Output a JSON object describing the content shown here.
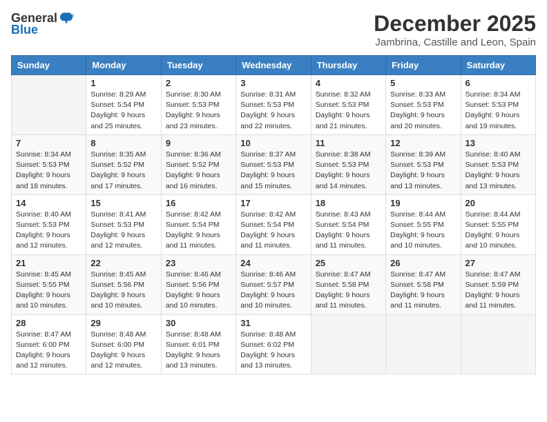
{
  "logo": {
    "general": "General",
    "blue": "Blue"
  },
  "title": "December 2025",
  "location": "Jambrina, Castille and Leon, Spain",
  "weekdays": [
    "Sunday",
    "Monday",
    "Tuesday",
    "Wednesday",
    "Thursday",
    "Friday",
    "Saturday"
  ],
  "weeks": [
    [
      {
        "day": "",
        "info": ""
      },
      {
        "day": "1",
        "info": "Sunrise: 8:29 AM\nSunset: 5:54 PM\nDaylight: 9 hours\nand 25 minutes."
      },
      {
        "day": "2",
        "info": "Sunrise: 8:30 AM\nSunset: 5:53 PM\nDaylight: 9 hours\nand 23 minutes."
      },
      {
        "day": "3",
        "info": "Sunrise: 8:31 AM\nSunset: 5:53 PM\nDaylight: 9 hours\nand 22 minutes."
      },
      {
        "day": "4",
        "info": "Sunrise: 8:32 AM\nSunset: 5:53 PM\nDaylight: 9 hours\nand 21 minutes."
      },
      {
        "day": "5",
        "info": "Sunrise: 8:33 AM\nSunset: 5:53 PM\nDaylight: 9 hours\nand 20 minutes."
      },
      {
        "day": "6",
        "info": "Sunrise: 8:34 AM\nSunset: 5:53 PM\nDaylight: 9 hours\nand 19 minutes."
      }
    ],
    [
      {
        "day": "7",
        "info": "Sunrise: 8:34 AM\nSunset: 5:53 PM\nDaylight: 9 hours\nand 18 minutes."
      },
      {
        "day": "8",
        "info": "Sunrise: 8:35 AM\nSunset: 5:52 PM\nDaylight: 9 hours\nand 17 minutes."
      },
      {
        "day": "9",
        "info": "Sunrise: 8:36 AM\nSunset: 5:52 PM\nDaylight: 9 hours\nand 16 minutes."
      },
      {
        "day": "10",
        "info": "Sunrise: 8:37 AM\nSunset: 5:53 PM\nDaylight: 9 hours\nand 15 minutes."
      },
      {
        "day": "11",
        "info": "Sunrise: 8:38 AM\nSunset: 5:53 PM\nDaylight: 9 hours\nand 14 minutes."
      },
      {
        "day": "12",
        "info": "Sunrise: 8:39 AM\nSunset: 5:53 PM\nDaylight: 9 hours\nand 13 minutes."
      },
      {
        "day": "13",
        "info": "Sunrise: 8:40 AM\nSunset: 5:53 PM\nDaylight: 9 hours\nand 13 minutes."
      }
    ],
    [
      {
        "day": "14",
        "info": "Sunrise: 8:40 AM\nSunset: 5:53 PM\nDaylight: 9 hours\nand 12 minutes."
      },
      {
        "day": "15",
        "info": "Sunrise: 8:41 AM\nSunset: 5:53 PM\nDaylight: 9 hours\nand 12 minutes."
      },
      {
        "day": "16",
        "info": "Sunrise: 8:42 AM\nSunset: 5:54 PM\nDaylight: 9 hours\nand 11 minutes."
      },
      {
        "day": "17",
        "info": "Sunrise: 8:42 AM\nSunset: 5:54 PM\nDaylight: 9 hours\nand 11 minutes."
      },
      {
        "day": "18",
        "info": "Sunrise: 8:43 AM\nSunset: 5:54 PM\nDaylight: 9 hours\nand 11 minutes."
      },
      {
        "day": "19",
        "info": "Sunrise: 8:44 AM\nSunset: 5:55 PM\nDaylight: 9 hours\nand 10 minutes."
      },
      {
        "day": "20",
        "info": "Sunrise: 8:44 AM\nSunset: 5:55 PM\nDaylight: 9 hours\nand 10 minutes."
      }
    ],
    [
      {
        "day": "21",
        "info": "Sunrise: 8:45 AM\nSunset: 5:55 PM\nDaylight: 9 hours\nand 10 minutes."
      },
      {
        "day": "22",
        "info": "Sunrise: 8:45 AM\nSunset: 5:56 PM\nDaylight: 9 hours\nand 10 minutes."
      },
      {
        "day": "23",
        "info": "Sunrise: 8:46 AM\nSunset: 5:56 PM\nDaylight: 9 hours\nand 10 minutes."
      },
      {
        "day": "24",
        "info": "Sunrise: 8:46 AM\nSunset: 5:57 PM\nDaylight: 9 hours\nand 10 minutes."
      },
      {
        "day": "25",
        "info": "Sunrise: 8:47 AM\nSunset: 5:58 PM\nDaylight: 9 hours\nand 11 minutes."
      },
      {
        "day": "26",
        "info": "Sunrise: 8:47 AM\nSunset: 5:58 PM\nDaylight: 9 hours\nand 11 minutes."
      },
      {
        "day": "27",
        "info": "Sunrise: 8:47 AM\nSunset: 5:59 PM\nDaylight: 9 hours\nand 11 minutes."
      }
    ],
    [
      {
        "day": "28",
        "info": "Sunrise: 8:47 AM\nSunset: 6:00 PM\nDaylight: 9 hours\nand 12 minutes."
      },
      {
        "day": "29",
        "info": "Sunrise: 8:48 AM\nSunset: 6:00 PM\nDaylight: 9 hours\nand 12 minutes."
      },
      {
        "day": "30",
        "info": "Sunrise: 8:48 AM\nSunset: 6:01 PM\nDaylight: 9 hours\nand 13 minutes."
      },
      {
        "day": "31",
        "info": "Sunrise: 8:48 AM\nSunset: 6:02 PM\nDaylight: 9 hours\nand 13 minutes."
      },
      {
        "day": "",
        "info": ""
      },
      {
        "day": "",
        "info": ""
      },
      {
        "day": "",
        "info": ""
      }
    ]
  ]
}
